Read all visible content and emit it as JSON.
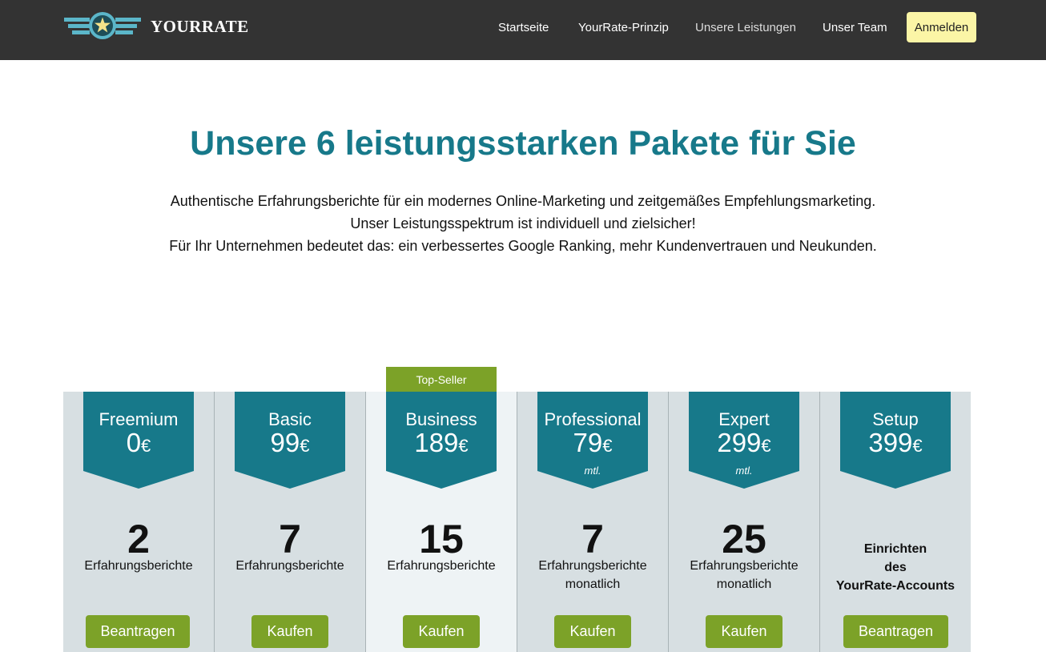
{
  "brand": {
    "name": "YOURRATE",
    "icon": "star-wings-logo"
  },
  "nav": {
    "items": [
      {
        "label": "Startseite",
        "active": false
      },
      {
        "label": "YourRate-Prinzip",
        "active": false
      },
      {
        "label": "Unsere Leistungen",
        "active": true
      },
      {
        "label": "Unser Team",
        "active": false
      }
    ],
    "login_label": "Anmelden"
  },
  "hero": {
    "title": "Unsere 6 leistungsstarken Pakete für Sie",
    "lines": [
      "Authentische Erfahrungsberichte für ein modernes Online-Marketing und zeitgemäßes Empfehlungsmarketing.",
      "Unser Leistungsspektrum ist individuell und zielsicher!",
      "Für Ihr Unternehmen bedeutet das: ein verbessertes Google Ranking, mehr Kundenvertrauen und Neukunden."
    ]
  },
  "badge": {
    "label": "Top-Seller"
  },
  "plans": [
    {
      "name": "Freemium",
      "price": "0",
      "currency": "€",
      "note": "",
      "count": "2",
      "unit": "Erfahrungsberichte",
      "unit_sub": "",
      "cta": "Beantragen"
    },
    {
      "name": "Basic",
      "price": "99",
      "currency": "€",
      "note": "",
      "count": "7",
      "unit": "Erfahrungsberichte",
      "unit_sub": "",
      "cta": "Kaufen"
    },
    {
      "name": "Business",
      "price": "189",
      "currency": "€",
      "note": "",
      "count": "15",
      "unit": "Erfahrungsberichte",
      "unit_sub": "",
      "cta": "Kaufen"
    },
    {
      "name": "Professional",
      "price": "79",
      "currency": "€",
      "note": "mtl.",
      "count": "7",
      "unit": "Erfahrungsberichte",
      "unit_sub": "monatlich",
      "cta": "Kaufen"
    },
    {
      "name": "Expert",
      "price": "299",
      "currency": "€",
      "note": "mtl.",
      "count": "25",
      "unit": "Erfahrungsberichte",
      "unit_sub": "monatlich",
      "cta": "Kaufen"
    },
    {
      "name": "Setup",
      "price": "399",
      "currency": "€",
      "note": "",
      "setup_lines": [
        "Einrichten",
        "des",
        "YourRate-Accounts"
      ],
      "cta": "Beantragen"
    }
  ],
  "colors": {
    "navbar": "#333333",
    "accent": "#17798a",
    "green": "#7ca228",
    "login": "#fbf5a6",
    "panel": "#d7dfe2"
  }
}
